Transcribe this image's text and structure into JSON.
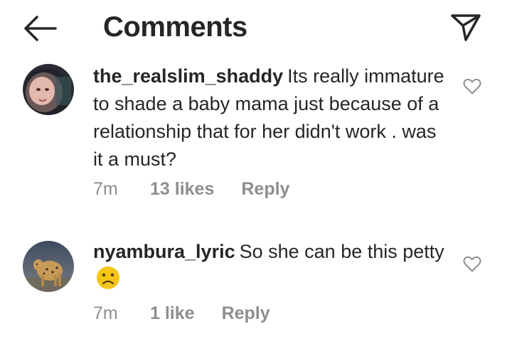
{
  "header": {
    "title": "Comments",
    "back_icon": "arrow-left-icon",
    "send_icon": "paper-plane-icon"
  },
  "comments": [
    {
      "username": "the_realslim_shaddy",
      "text": "Its really immature to shade a baby mama just because of a relationship that for her didn't work . was it a must?",
      "time": "7m",
      "likes": "13 likes",
      "reply": "Reply",
      "avatar_icon": "avatar-photo",
      "heart_icon": "heart-outline-icon"
    },
    {
      "username": "nyambura_lyric",
      "text": "So she can be this petty",
      "emoji": "frowning-face-emoji",
      "time": "7m",
      "likes": "1 like",
      "reply": "Reply",
      "avatar_icon": "avatar-cheetah-photo",
      "heart_icon": "heart-outline-icon"
    }
  ],
  "colors": {
    "text": "#262626",
    "muted": "#8e8e8e",
    "emoji": "#f5c518"
  }
}
